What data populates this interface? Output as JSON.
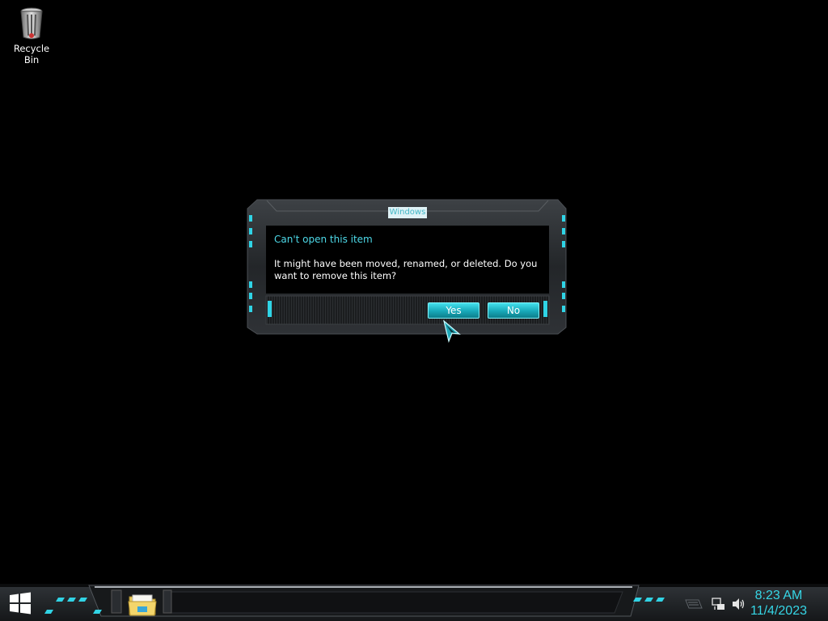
{
  "desktop": {
    "icons": [
      {
        "label": "Recycle Bin",
        "icon": "recycle-bin-icon"
      }
    ]
  },
  "dialog": {
    "title": "Windows",
    "main_instruction": "Can't open this item",
    "content": "It might have been moved, renamed, or deleted. Do you want to remove this item?",
    "buttons": {
      "yes": "Yes",
      "no": "No"
    }
  },
  "taskbar": {
    "start_icon": "windows-logo-icon",
    "pinned": [
      {
        "icon": "file-explorer-icon"
      }
    ],
    "tray": {
      "icons": [
        "flag-icon",
        "network-icon",
        "volume-icon"
      ],
      "time": "8:23 AM",
      "date": "11/4/2023"
    }
  },
  "colors": {
    "accent": "#36d6e6",
    "desktop_bg": "#000000",
    "frame": "#2a2d30"
  }
}
